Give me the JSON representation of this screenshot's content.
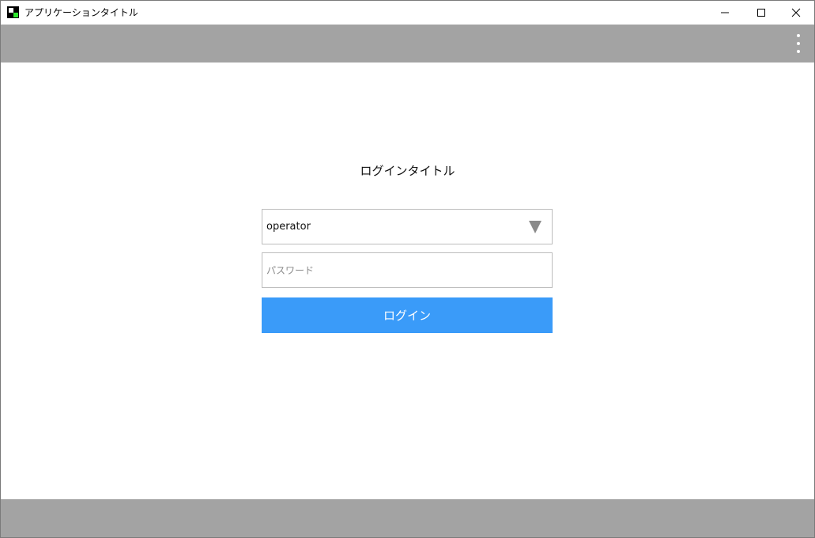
{
  "window": {
    "title": "アプリケーションタイトル"
  },
  "icons": {
    "app": "app-logo-icon",
    "minimize": "minimize-icon",
    "maximize": "maximize-icon",
    "close": "close-icon",
    "menu": "more-vertical-icon",
    "dropdown": "caret-down-icon"
  },
  "login": {
    "title": "ログインタイトル",
    "user_select_value": "operator",
    "password_placeholder": "パスワード",
    "password_value": "",
    "button_label": "ログイン"
  },
  "colors": {
    "bar": "#a3a3a3",
    "accent": "#3a9bf9",
    "border": "#bdbdbd"
  }
}
